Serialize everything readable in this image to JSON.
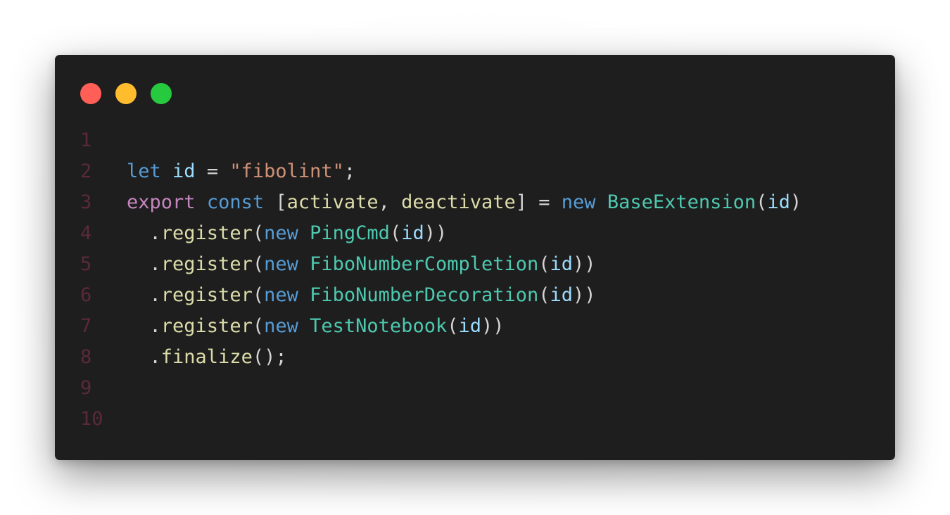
{
  "window": {
    "traffic_lights": [
      {
        "name": "close",
        "color": "#ff5f56"
      },
      {
        "name": "minimize",
        "color": "#ffbd2e"
      },
      {
        "name": "maximize",
        "color": "#27c93f"
      }
    ]
  },
  "code": {
    "line_numbers": [
      "1",
      "2",
      "3",
      "4",
      "5",
      "6",
      "7",
      "8",
      "9",
      "10"
    ],
    "lines": [
      [],
      [
        {
          "t": "let",
          "c": "kw"
        },
        {
          "t": " ",
          "c": "punc"
        },
        {
          "t": "id",
          "c": "var"
        },
        {
          "t": " = ",
          "c": "punc"
        },
        {
          "t": "\"fibolint\"",
          "c": "str"
        },
        {
          "t": ";",
          "c": "punc"
        }
      ],
      [
        {
          "t": "export",
          "c": "kw2"
        },
        {
          "t": " ",
          "c": "punc"
        },
        {
          "t": "const",
          "c": "kw"
        },
        {
          "t": " [",
          "c": "punc"
        },
        {
          "t": "activate",
          "c": "fn"
        },
        {
          "t": ", ",
          "c": "punc"
        },
        {
          "t": "deactivate",
          "c": "fn"
        },
        {
          "t": "] = ",
          "c": "punc"
        },
        {
          "t": "new",
          "c": "kw"
        },
        {
          "t": " ",
          "c": "punc"
        },
        {
          "t": "BaseExtension",
          "c": "cls"
        },
        {
          "t": "(",
          "c": "punc"
        },
        {
          "t": "id",
          "c": "var"
        },
        {
          "t": ")",
          "c": "punc"
        }
      ],
      [
        {
          "t": "  .",
          "c": "punc"
        },
        {
          "t": "register",
          "c": "fn"
        },
        {
          "t": "(",
          "c": "punc"
        },
        {
          "t": "new",
          "c": "kw"
        },
        {
          "t": " ",
          "c": "punc"
        },
        {
          "t": "PingCmd",
          "c": "cls"
        },
        {
          "t": "(",
          "c": "punc"
        },
        {
          "t": "id",
          "c": "var"
        },
        {
          "t": "))",
          "c": "punc"
        }
      ],
      [
        {
          "t": "  .",
          "c": "punc"
        },
        {
          "t": "register",
          "c": "fn"
        },
        {
          "t": "(",
          "c": "punc"
        },
        {
          "t": "new",
          "c": "kw"
        },
        {
          "t": " ",
          "c": "punc"
        },
        {
          "t": "FiboNumberCompletion",
          "c": "cls"
        },
        {
          "t": "(",
          "c": "punc"
        },
        {
          "t": "id",
          "c": "var"
        },
        {
          "t": "))",
          "c": "punc"
        }
      ],
      [
        {
          "t": "  .",
          "c": "punc"
        },
        {
          "t": "register",
          "c": "fn"
        },
        {
          "t": "(",
          "c": "punc"
        },
        {
          "t": "new",
          "c": "kw"
        },
        {
          "t": " ",
          "c": "punc"
        },
        {
          "t": "FiboNumberDecoration",
          "c": "cls"
        },
        {
          "t": "(",
          "c": "punc"
        },
        {
          "t": "id",
          "c": "var"
        },
        {
          "t": "))",
          "c": "punc"
        }
      ],
      [
        {
          "t": "  .",
          "c": "punc"
        },
        {
          "t": "register",
          "c": "fn"
        },
        {
          "t": "(",
          "c": "punc"
        },
        {
          "t": "new",
          "c": "kw"
        },
        {
          "t": " ",
          "c": "punc"
        },
        {
          "t": "TestNotebook",
          "c": "cls"
        },
        {
          "t": "(",
          "c": "punc"
        },
        {
          "t": "id",
          "c": "var"
        },
        {
          "t": "))",
          "c": "punc"
        }
      ],
      [
        {
          "t": "  .",
          "c": "punc"
        },
        {
          "t": "finalize",
          "c": "fn"
        },
        {
          "t": "();",
          "c": "punc"
        }
      ],
      [],
      []
    ]
  }
}
